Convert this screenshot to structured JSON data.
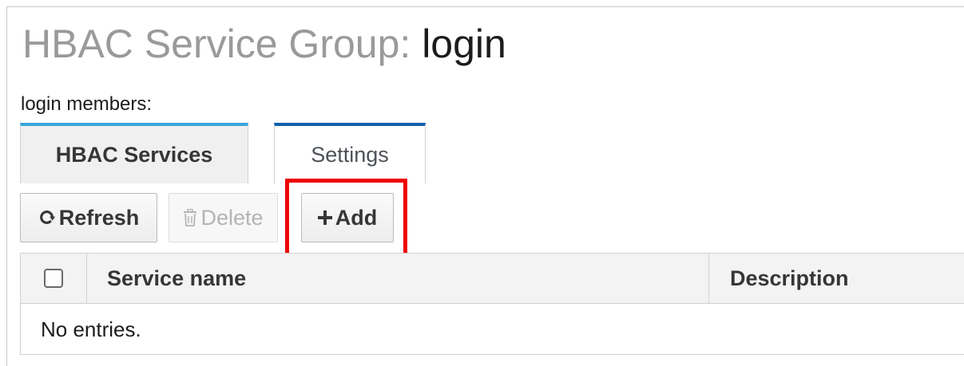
{
  "header": {
    "title_prefix": "HBAC Service Group:",
    "title_name": "login"
  },
  "members_label": "login members:",
  "tabs": [
    {
      "label": "HBAC Services",
      "active": true
    },
    {
      "label": "Settings",
      "active": false
    }
  ],
  "toolbar": {
    "refresh": {
      "label": "Refresh",
      "icon": "refresh-icon",
      "enabled": true
    },
    "delete": {
      "label": "Delete",
      "icon": "trash-icon",
      "enabled": false
    },
    "add": {
      "label": "Add",
      "icon": "plus-icon",
      "enabled": true,
      "highlighted": true
    }
  },
  "table": {
    "columns": [
      "Service name",
      "Description"
    ],
    "empty_text": "No entries."
  },
  "colors": {
    "highlight": "#ee0000",
    "active_tab_accent": "#39a5dc",
    "inactive_tab_accent": "#0d60ae"
  }
}
